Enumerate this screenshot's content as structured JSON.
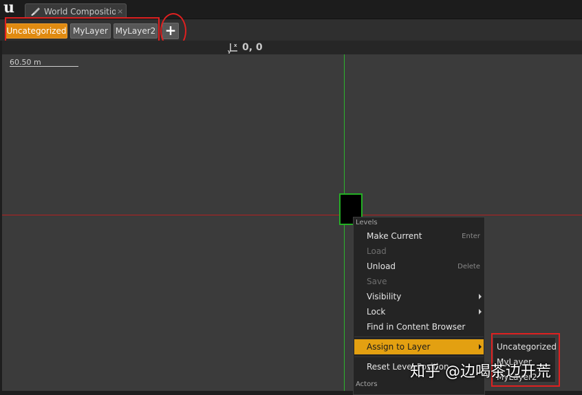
{
  "app": {
    "logo_glyph": "u",
    "tab_title": "World Composition",
    "tab_icon": "brush-icon",
    "tab_close": "×"
  },
  "layers": {
    "items": [
      {
        "label": "Uncategorized",
        "active": true
      },
      {
        "label": "MyLayer",
        "active": false
      },
      {
        "label": "MyLayer2",
        "active": false
      }
    ],
    "add_label": "+",
    "active_color": "#e08a10"
  },
  "coords": {
    "readout": "0, 0"
  },
  "viewport": {
    "scale_label": "60.50 m",
    "x_axis_color": "#b52020",
    "y_axis_color": "#2db52d"
  },
  "context_menu": {
    "section_levels": "Levels",
    "items": [
      {
        "label": "Make Current",
        "shortcut": "Enter",
        "enabled": true
      },
      {
        "label": "Load",
        "shortcut": "",
        "enabled": false
      },
      {
        "label": "Unload",
        "shortcut": "Delete",
        "enabled": true
      },
      {
        "label": "Save",
        "shortcut": "",
        "enabled": false
      },
      {
        "label": "Visibility",
        "submenu": true,
        "enabled": true
      },
      {
        "label": "Lock",
        "submenu": true,
        "enabled": true
      },
      {
        "label": "Find in Content Browser",
        "enabled": true
      },
      {
        "label": "Assign to Layer",
        "submenu": true,
        "enabled": true,
        "highlighted": true
      },
      {
        "label": "Reset Level Position",
        "enabled": true
      }
    ],
    "section_actors": "Actors",
    "highlight_color": "#e3a011"
  },
  "submenu": {
    "items": [
      "Uncategorized",
      "MyLayer",
      "MyLayer2"
    ]
  },
  "watermark": "知乎 @边喝茶边开荒"
}
